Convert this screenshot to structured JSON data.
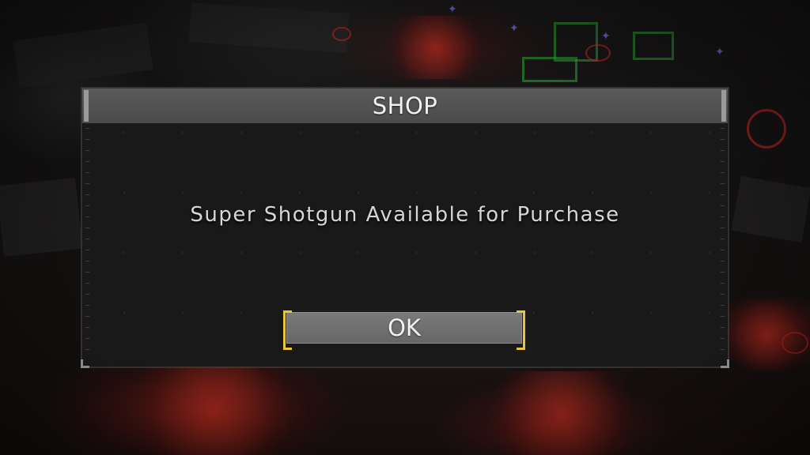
{
  "dialog": {
    "title": "SHOP",
    "message": "Super Shotgun Available for Purchase",
    "ok_label": "OK"
  },
  "colors": {
    "titlebar": "#555555",
    "panel": "#1a1a1a",
    "button": "#707070",
    "button_highlight": "#e8c53a",
    "text": "#f2f2f2"
  },
  "icons": {
    "lock_marker": "lock-icon"
  }
}
